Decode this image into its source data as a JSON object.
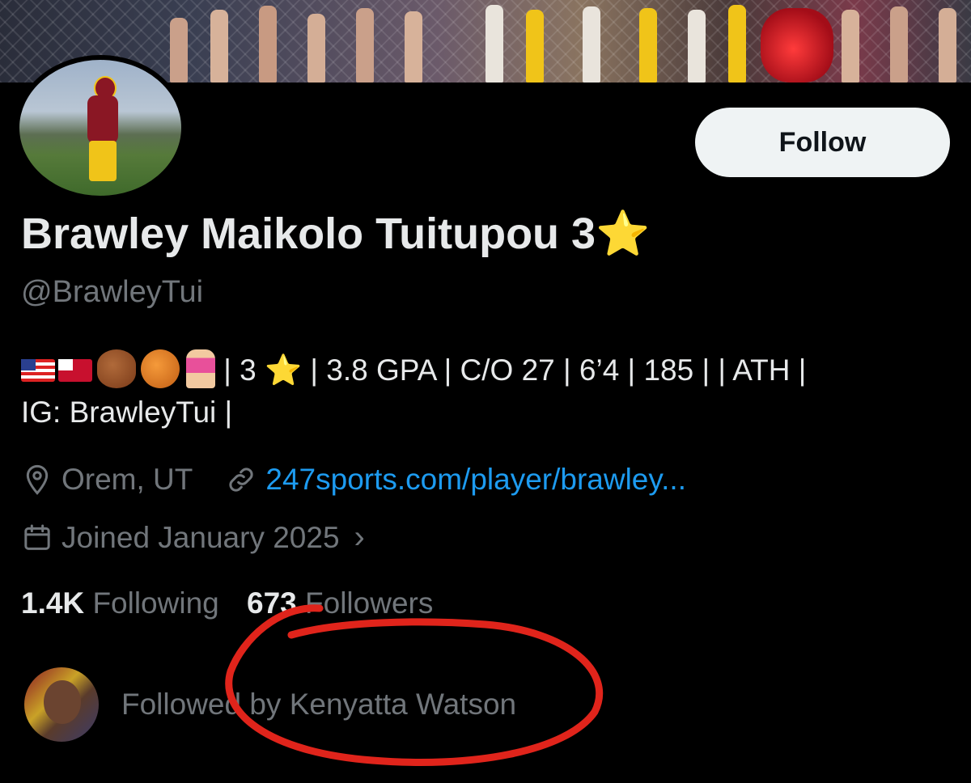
{
  "profile": {
    "name": "Brawley Maikolo Tuitupou 3",
    "name_star": "⭐",
    "handle": "@BrawleyTui",
    "follow_label": "Follow"
  },
  "bio": {
    "text_after_emojis": "| 3 ",
    "star": "⭐",
    "text_rest": " | 3.8 GPA | C/O 27 | 6’4 | 185 | | ATH |",
    "line2": "IG: BrawleyTui |"
  },
  "meta": {
    "location": "Orem, UT",
    "link": "247sports.com/player/brawley...",
    "joined": "Joined January 2025",
    "joined_chevron": "›"
  },
  "stats": {
    "following_count": "1.4K",
    "following_label": "Following",
    "followers_count": "673",
    "followers_label": "Followers"
  },
  "followed_by": {
    "text": "Followed by Kenyatta Watson"
  },
  "icons": {
    "location": "map-pin-icon",
    "link": "link-icon",
    "calendar": "calendar-icon"
  },
  "colors": {
    "background": "#000000",
    "primary_text": "#e7e9ea",
    "secondary_text": "#71767b",
    "link": "#1d9bf0",
    "follow_button_bg": "#eff3f4",
    "annotation_red": "#e0241b"
  }
}
